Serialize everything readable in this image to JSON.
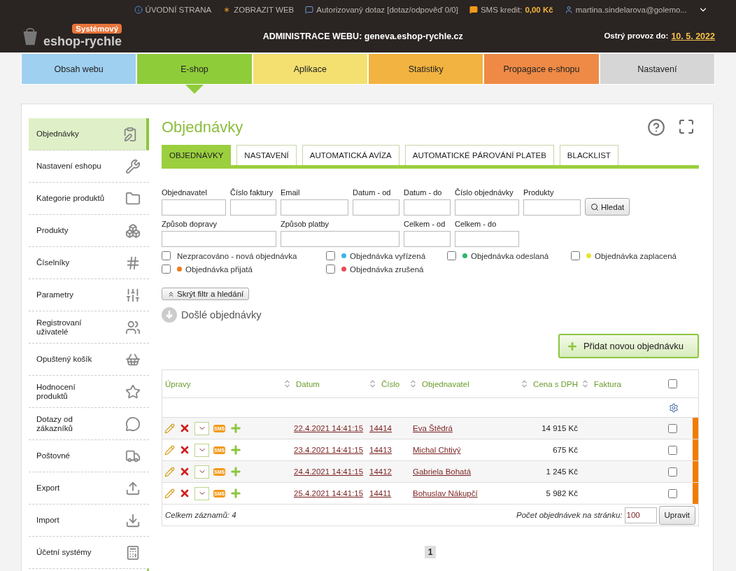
{
  "top_bar": {
    "links": [
      {
        "kind": "info",
        "text": "ÚVODNÍ STRANA"
      },
      {
        "kind": "web",
        "text": "ZOBRAZIT WEB"
      },
      {
        "kind": "query",
        "text": "Autorizovaný dotaz [dotaz/odpověď 0/0]"
      }
    ],
    "sms": {
      "label": "SMS kredit:",
      "value": "0,00 Kč"
    },
    "user": "martina.sindelarova@golemo..."
  },
  "logo": {
    "badge": "Systémový",
    "name": "eshop-rychle"
  },
  "header": {
    "title": "ADMINISTRACE WEBU: geneva.eshop-rychle.cz",
    "deadline_label": "Ostrý provoz do:",
    "deadline": "10. 5. 2022"
  },
  "nav": [
    {
      "label": "Obsah webu",
      "color": "#9fd0f0",
      "selected": false
    },
    {
      "label": "E-shop",
      "color": "#8fcc3a",
      "selected": true
    },
    {
      "label": "Aplikace",
      "color": "#f3e070",
      "selected": false
    },
    {
      "label": "Statistiky",
      "color": "#f2b340",
      "selected": false
    },
    {
      "label": "Propagace e-shopu",
      "color": "#ee8a46",
      "selected": false
    },
    {
      "label": "Nastavení",
      "color": "#d6d6d6",
      "selected": false
    }
  ],
  "sidebar": {
    "items": [
      {
        "label": "Objednávky",
        "selected": true
      },
      {
        "label": "Nastavení eshopu",
        "selected": false
      },
      {
        "label": "Kategorie produktů",
        "selected": false
      },
      {
        "label": "Produkty",
        "selected": false
      },
      {
        "label": "Číselníky",
        "selected": false
      },
      {
        "label": "Parametry",
        "selected": false
      },
      {
        "label": "Registrovaní uživatelé",
        "selected": false
      },
      {
        "label": "Opuštený košík",
        "selected": false
      },
      {
        "label": "Hodnocení produktů",
        "selected": false
      },
      {
        "label": "Dotazy od zákazníků",
        "selected": false
      },
      {
        "label": "Poštovné",
        "selected": false
      },
      {
        "label": "Export",
        "selected": false
      },
      {
        "label": "Import",
        "selected": false
      },
      {
        "label": "Účetní systémy",
        "selected": false
      }
    ]
  },
  "page_title": "Objednávky",
  "tabs": [
    {
      "label": "OBJEDNÁVKY",
      "selected": true
    },
    {
      "label": "NASTAVENÍ",
      "selected": false
    },
    {
      "label": "AUTOMATICKÁ AVÍZA",
      "selected": false
    },
    {
      "label": "AUTOMATICKÉ PÁROVÁNÍ PLATEB",
      "selected": false
    },
    {
      "label": "BLACKLIST",
      "selected": false
    }
  ],
  "filter": {
    "fields": [
      "Objednavatel",
      "Číslo faktury",
      "Email",
      "Datum - od",
      "Datum - do",
      "Číslo objednávky",
      "Produkty",
      "Způsob dopravy",
      "Způsob platby",
      "Celkem - od",
      "Celkem - do"
    ],
    "search_button": "Hledat",
    "statuses": [
      {
        "label": "Nezpracováno - nová objednávka",
        "checked": false
      },
      {
        "label": "Objednávka vyřízená",
        "checked": false,
        "color": "#3bb4ea"
      },
      {
        "label": "Objednávka odeslaná",
        "checked": false,
        "color": "#2fb56a"
      },
      {
        "label": "Objednávka zaplacená",
        "checked": false,
        "color": "#e8e236"
      },
      {
        "label": "Objednávka přijatá",
        "checked": false,
        "color": "#ee7a1a"
      },
      {
        "label": "Objednávka zrušená",
        "checked": false,
        "color": "#e84b5a"
      }
    ],
    "hide_button": "Skrýt filtr a hledání"
  },
  "section_title": "Došlé objednávky",
  "add_button": "Přidat novou objednávku",
  "table": {
    "columns": [
      {
        "label": "Úpravy",
        "sortable": false
      },
      {
        "label": "Datum",
        "sortable": true
      },
      {
        "label": "Číslo",
        "sortable": true
      },
      {
        "label": "Objednavatel",
        "sortable": true
      },
      {
        "label": "Cena s DPH",
        "sortable": true
      },
      {
        "label": "Faktura",
        "sortable": true
      }
    ],
    "select_all": false,
    "rows": [
      {
        "sms_label": "SMS",
        "date": "22.4.2021 14:41:15",
        "number": "14414",
        "customer": "Eva Štědrá",
        "price": "14 915 Kč",
        "checked": false,
        "color": "#f07d00"
      },
      {
        "sms_label": "SMS",
        "date": "23.4.2021 14:41:15",
        "number": "14413",
        "customer": "Michal Chtivý",
        "price": "675 Kč",
        "checked": false,
        "color": "#f07d00"
      },
      {
        "sms_label": "SMS",
        "date": "24.4.2021 14:41:15",
        "number": "14412",
        "customer": "Gabriela Bohatá",
        "price": "1 245 Kč",
        "checked": false,
        "color": "#f07d00"
      },
      {
        "sms_label": "SMS",
        "date": "25.4.2021 14:41:15",
        "number": "14411",
        "customer": "Bohuslav Nákupčí",
        "price": "5 982 Kč",
        "checked": false,
        "color": "#f07d00"
      }
    ],
    "total": "Celkem záznamů: 4",
    "per_page_label": "Počet objednávek na stránku:",
    "per_page": "100",
    "apply_button": "Upravit"
  },
  "pagination": [
    {
      "label": "1",
      "selected": true
    }
  ]
}
